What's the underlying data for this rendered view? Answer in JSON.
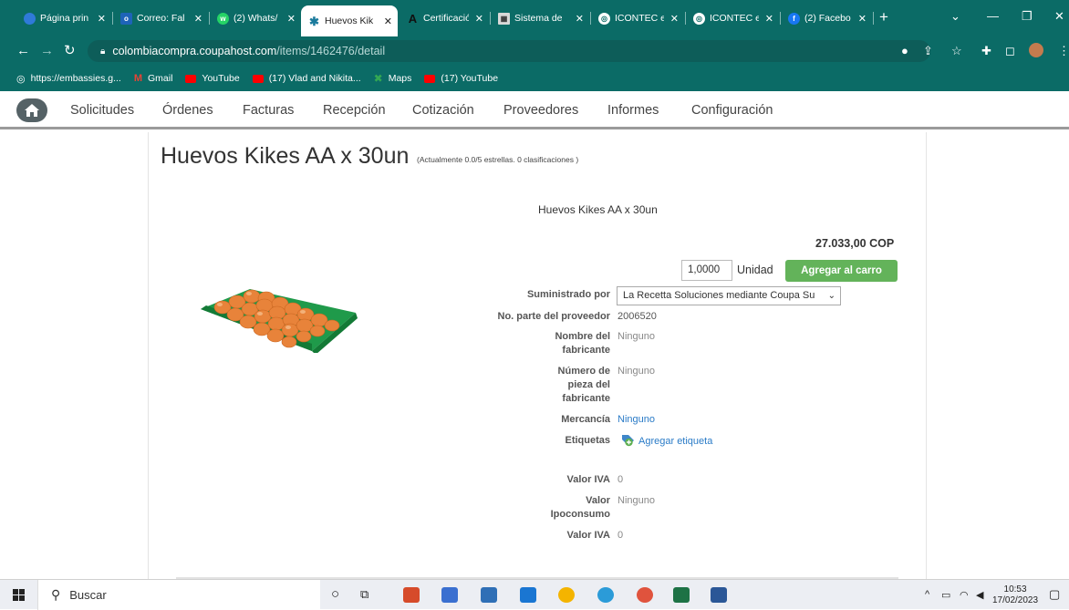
{
  "browser": {
    "tabs": [
      {
        "label": "Página prin",
        "icon": "edge-icon",
        "active": false
      },
      {
        "label": "Correo: Fal",
        "icon": "outlook-icon",
        "active": false
      },
      {
        "label": "(2) Whats/",
        "icon": "whatsapp-icon",
        "active": false
      },
      {
        "label": "Huevos Kik",
        "icon": "coupa-icon",
        "active": true
      },
      {
        "label": "Certificació",
        "icon": "a-icon",
        "active": false
      },
      {
        "label": "Sistema de",
        "icon": "sistema-icon",
        "active": false
      },
      {
        "label": "ICONTEC e",
        "icon": "globe-icon",
        "active": false
      },
      {
        "label": "ICONTEC e",
        "icon": "globe-icon",
        "active": false
      },
      {
        "label": "(2) Facebo",
        "icon": "facebook-icon",
        "active": false
      }
    ],
    "url_domain": "colombiacompra.coupahost.com",
    "url_path": "/items/1462476/detail",
    "bookmarks": [
      {
        "label": "https://embassies.g...",
        "icon": "globe-icon"
      },
      {
        "label": "Gmail",
        "icon": "gmail-icon"
      },
      {
        "label": "YouTube",
        "icon": "youtube-icon"
      },
      {
        "label": "(17) Vlad and Nikita...",
        "icon": "youtube-icon"
      },
      {
        "label": "Maps",
        "icon": "maps-icon"
      },
      {
        "label": "(17) YouTube",
        "icon": "youtube-icon"
      }
    ]
  },
  "nav": {
    "items": [
      "Solicitudes",
      "Órdenes",
      "Facturas",
      "Recepción",
      "Cotización",
      "Proveedores",
      "Informes",
      "Configuración"
    ]
  },
  "item": {
    "title": "Huevos Kikes AA x 30un",
    "rating_note": "(Actualmente 0.0/5 estrellas. 0 clasificaciones )",
    "product_name": "Huevos Kikes AA x 30un",
    "price": "27.033,00 COP",
    "quantity": "1,0000",
    "unit": "Unidad",
    "add_to_cart": "Agregar al carro",
    "fields": {
      "supplier_label": "Suministrado por",
      "supplier_value": "La Recetta Soluciones mediante Coupa Su",
      "part_label": "No. parte del proveedor",
      "part_value": "2006520",
      "manufacturer_label_1": "Nombre del",
      "manufacturer_label_2": "fabricante",
      "manufacturer_value": "Ninguno",
      "mfr_part_label_1": "Número de",
      "mfr_part_label_2": "pieza del",
      "mfr_part_label_3": "fabricante",
      "mfr_part_value": "Ninguno",
      "commodity_label": "Mercancía",
      "commodity_value": "Ninguno",
      "tags_label": "Etiquetas",
      "tags_value": "Agregar etiqueta",
      "iva_label": "Valor IVA",
      "iva_value": "0",
      "ipo_label_1": "Valor",
      "ipo_label_2": "Ipoconsumo",
      "ipo_value": "Ninguno",
      "iva2_label": "Valor IVA",
      "iva2_value": "0"
    }
  },
  "taskbar": {
    "search_placeholder": "Buscar",
    "time": "10:53",
    "date": "17/02/2023"
  }
}
